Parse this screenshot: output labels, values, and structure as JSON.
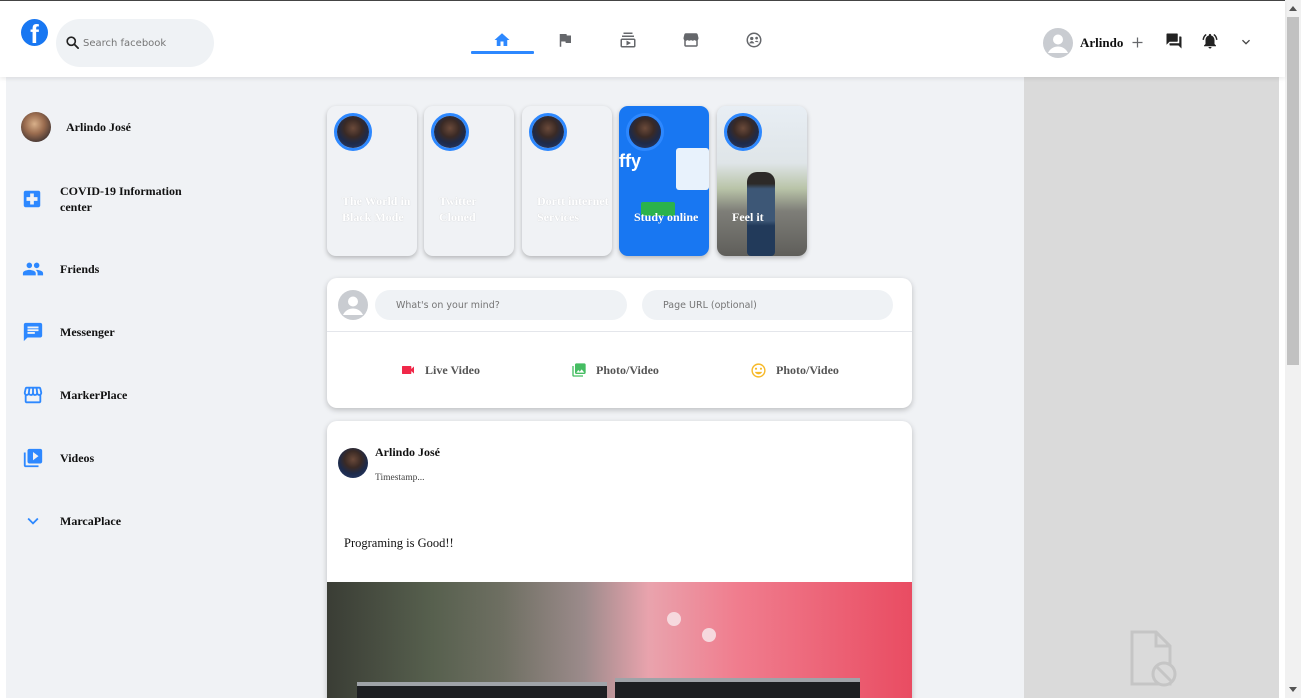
{
  "header": {
    "logo": "f",
    "search_placeholder": "Search facebook",
    "nav_tabs": [
      {
        "icon": "home-icon",
        "active": true
      },
      {
        "icon": "flag-icon",
        "active": false
      },
      {
        "icon": "subscriptions-icon",
        "active": false
      },
      {
        "icon": "storefront-icon",
        "active": false
      },
      {
        "icon": "supervised-user-circle-icon",
        "active": false
      }
    ],
    "user_name": "Arlindo",
    "right_icons": [
      "add-icon",
      "forum-icon",
      "notifications-active-icon",
      "expand-more-icon"
    ]
  },
  "sidebar": {
    "items": [
      {
        "label": "Arlindo José",
        "icon": "avatar"
      },
      {
        "label": "COVID-19 Information center",
        "icon": "local-hospital-icon"
      },
      {
        "label": "Friends",
        "icon": "people-icon"
      },
      {
        "label": "Messenger",
        "icon": "chat-icon"
      },
      {
        "label": "MarkerPlace",
        "icon": "storefront-icon"
      },
      {
        "label": "Videos",
        "icon": "video-library-icon"
      },
      {
        "label": "MarcaPlace",
        "icon": "expand-more-icon"
      }
    ],
    "icon_color": "#2d88ff"
  },
  "stories": [
    {
      "title": "The World in Black Mode"
    },
    {
      "title": "Twitter Cloned"
    },
    {
      "title": "Dortt internet Services"
    },
    {
      "title": "Study online"
    },
    {
      "title": "Feel it"
    }
  ],
  "composer": {
    "message_placeholder": "What's on your mind?",
    "url_placeholder": "Page URL (optional)",
    "actions": [
      {
        "label": "Live Video",
        "icon": "videocam-icon",
        "color": "#f02849"
      },
      {
        "label": "Photo/Video",
        "icon": "photo-library-icon",
        "color": "#45bd62"
      },
      {
        "label": "Photo/Video",
        "icon": "insert-emoticon-icon",
        "color": "#f7b928"
      }
    ]
  },
  "post": {
    "author": "Arlindo José",
    "timestamp": "Timestamp...",
    "message": "Programing is Good!!"
  }
}
